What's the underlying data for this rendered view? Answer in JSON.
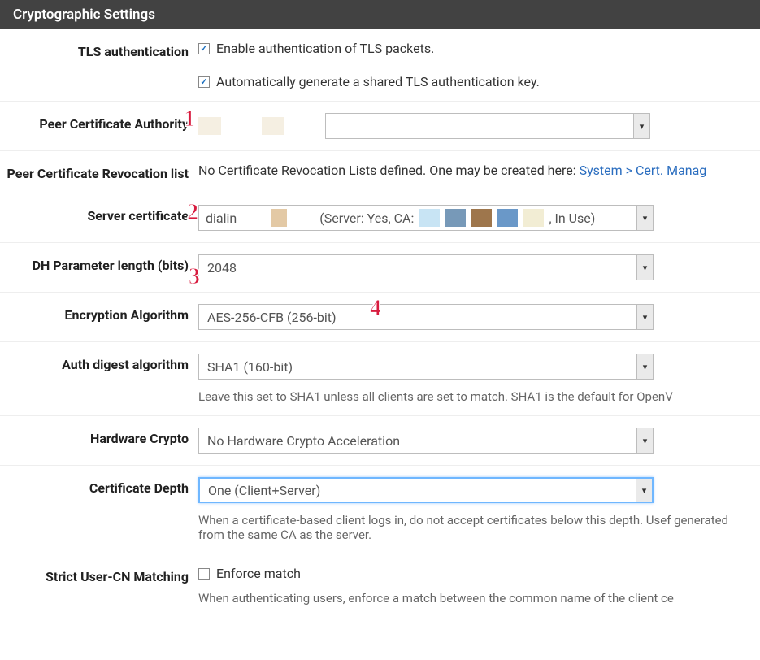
{
  "panel": {
    "title": "Cryptographic Settings"
  },
  "rows": {
    "tls_auth": {
      "label": "TLS authentication",
      "check1": "Enable authentication of TLS packets.",
      "check2": "Automatically generate a shared TLS authentication key."
    },
    "peer_ca": {
      "label": "Peer Certificate Authority",
      "value": ""
    },
    "peer_crl": {
      "label": "Peer Certificate Revocation list",
      "text": "No Certificate Revocation Lists defined. One may be created here: ",
      "link": "System > Cert. Manag"
    },
    "server_cert": {
      "label": "Server certificate",
      "prefix": "dialin",
      "mid": "(Server: Yes, CA: ",
      "suffix": ", In Use)"
    },
    "dh": {
      "label": "DH Parameter length (bits)",
      "value": "2048"
    },
    "enc": {
      "label": "Encryption Algorithm",
      "value": "AES-256-CFB (256-bit)"
    },
    "auth_digest": {
      "label": "Auth digest algorithm",
      "value": "SHA1 (160-bit)",
      "help": "Leave this set to SHA1 unless all clients are set to match. SHA1 is the default for OpenV"
    },
    "hw": {
      "label": "Hardware Crypto",
      "value": "No Hardware Crypto Acceleration"
    },
    "cert_depth": {
      "label": "Certificate Depth",
      "value": "One (Client+Server)",
      "help": "When a certificate-based client logs in, do not accept certificates below this depth. Usef generated from the same CA as the server."
    },
    "strict": {
      "label": "Strict User-CN Matching",
      "check": "Enforce match",
      "help": "When authenticating users, enforce a match between the common name of the client ce"
    }
  },
  "annotations": {
    "a1": "1",
    "a2": "2",
    "a3": "3",
    "a4": "4"
  }
}
